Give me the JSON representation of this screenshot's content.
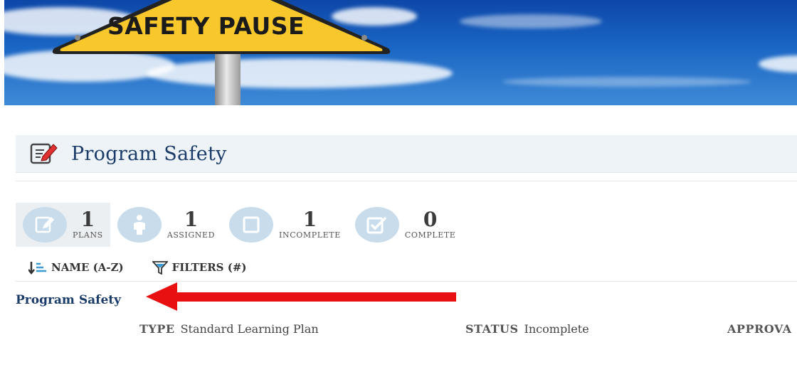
{
  "banner": {
    "sign_text": "SAFETY PAUSE"
  },
  "header": {
    "title": "Program Safety",
    "icon": "edit-document-icon"
  },
  "stats": [
    {
      "value": "1",
      "label": "PLANS",
      "icon": "edit-document-icon"
    },
    {
      "value": "1",
      "label": "ASSIGNED",
      "icon": "person-icon"
    },
    {
      "value": "1",
      "label": "INCOMPLETE",
      "icon": "empty-square-icon"
    },
    {
      "value": "0",
      "label": "COMPLETE",
      "icon": "checked-box-icon"
    }
  ],
  "toolbar": {
    "sort_label": "NAME (A-Z)",
    "filter_label": "FILTERS (#)"
  },
  "plan": {
    "name": "Program Safety",
    "type_label": "TYPE",
    "type_value": "Standard Learning Plan",
    "status_label": "STATUS",
    "status_value": "Incomplete",
    "approval_label": "APPROVA"
  },
  "colors": {
    "title": "#1b3c68",
    "stat_circle": "#c8dcec",
    "arrow": "#e81010",
    "sign": "#f7c72c"
  }
}
